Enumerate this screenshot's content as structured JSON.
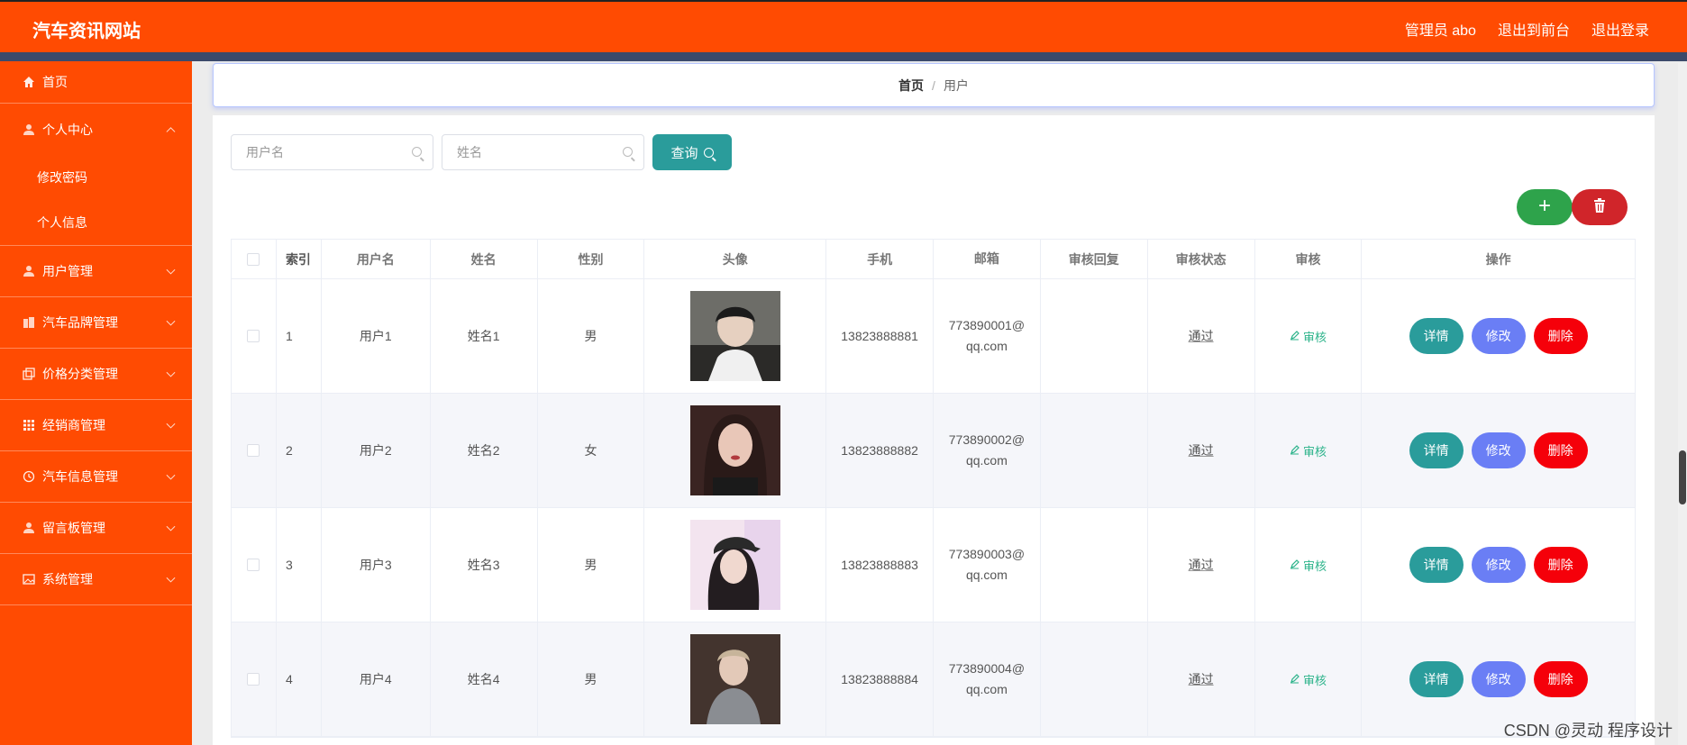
{
  "header": {
    "brand": "汽车资讯网站",
    "admin": "管理员 abo",
    "to_front": "退出到前台",
    "logout": "退出登录"
  },
  "sidebar": {
    "items": [
      {
        "label": "首页",
        "icon": "home-icon"
      },
      {
        "label": "个人中心",
        "icon": "user-icon",
        "expanded": true,
        "children": [
          "修改密码",
          "个人信息"
        ]
      },
      {
        "label": "用户管理",
        "icon": "user-icon"
      },
      {
        "label": "汽车品牌管理",
        "icon": "building-icon"
      },
      {
        "label": "价格分类管理",
        "icon": "copy-icon"
      },
      {
        "label": "经销商管理",
        "icon": "grid-icon"
      },
      {
        "label": "汽车信息管理",
        "icon": "clock-icon"
      },
      {
        "label": "留言板管理",
        "icon": "user-icon"
      },
      {
        "label": "系统管理",
        "icon": "picture-icon"
      }
    ]
  },
  "breadcrumb": {
    "home": "首页",
    "sep": "/",
    "current": "用户"
  },
  "search": {
    "username_placeholder": "用户名",
    "name_placeholder": "姓名",
    "query_label": "查询"
  },
  "actions": {
    "add": "+"
  },
  "table": {
    "headers": [
      "索引",
      "用户名",
      "姓名",
      "性别",
      "头像",
      "手机",
      "邮箱",
      "审核回复",
      "审核状态",
      "审核",
      "操作"
    ],
    "rows": [
      {
        "idx": "1",
        "user": "用户1",
        "name": "姓名1",
        "sex": "男",
        "phone": "13823888881",
        "mail1": "773890001@",
        "mail2": "qq.com",
        "reply": "",
        "state": "通过",
        "audit": "审核"
      },
      {
        "idx": "2",
        "user": "用户2",
        "name": "姓名2",
        "sex": "女",
        "phone": "13823888882",
        "mail1": "773890002@",
        "mail2": "qq.com",
        "reply": "",
        "state": "通过",
        "audit": "审核"
      },
      {
        "idx": "3",
        "user": "用户3",
        "name": "姓名3",
        "sex": "男",
        "phone": "13823888883",
        "mail1": "773890003@",
        "mail2": "qq.com",
        "reply": "",
        "state": "通过",
        "audit": "审核"
      },
      {
        "idx": "4",
        "user": "用户4",
        "name": "姓名4",
        "sex": "男",
        "phone": "13823888884",
        "mail1": "773890004@",
        "mail2": "qq.com",
        "reply": "",
        "state": "通过",
        "audit": "审核"
      }
    ],
    "ops": {
      "detail": "详情",
      "edit": "修改",
      "delete": "删除"
    }
  },
  "colors": {
    "primary": "#ff4b02",
    "teal": "#2a9c9b",
    "blue": "#6a7ef5",
    "red": "#f5000a",
    "green": "#2ea34b"
  },
  "watermark": "CSDN @灵动 程序设计"
}
